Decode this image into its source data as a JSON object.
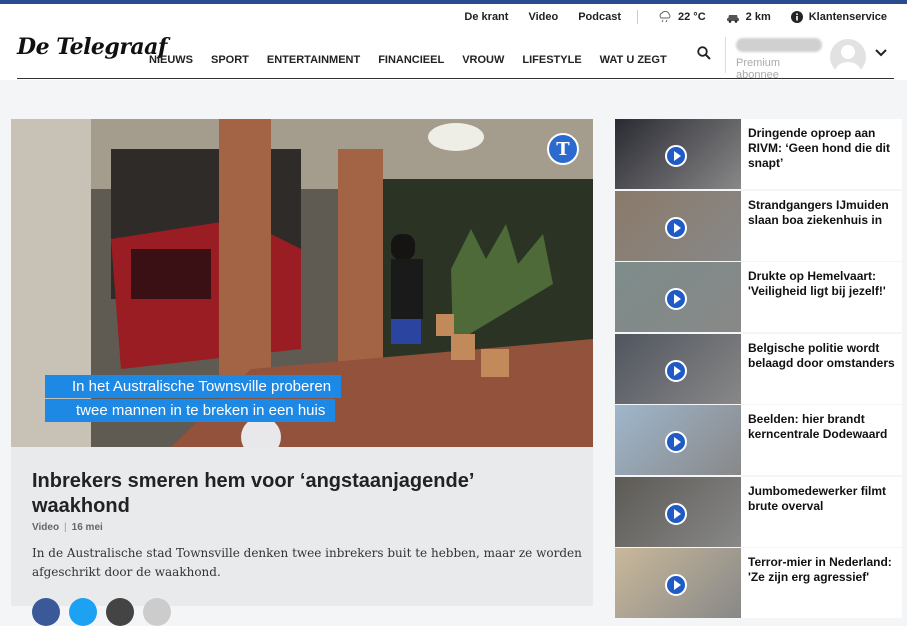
{
  "utility": {
    "krant": "De krant",
    "video": "Video",
    "podcast": "Podcast",
    "weather": "22 °C",
    "traffic": "2 km",
    "service": "Klantenservice"
  },
  "brand": {
    "logo": "De Telegraaf"
  },
  "nav": [
    "NIEUWS",
    "SPORT",
    "ENTERTAINMENT",
    "FINANCIEEL",
    "VROUW",
    "LIFESTYLE",
    "WAT U ZEGT"
  ],
  "account": {
    "subscription": "Premium abonnee"
  },
  "hero": {
    "badge": "T",
    "caption_line1": "In het Australische Townsville proberen",
    "caption_line2": "twee mannen in te breken in een huis",
    "title": "Inbrekers smeren hem voor ‘angstaanjagende’ waakhond",
    "category": "Video",
    "date": "16 mei",
    "lead": "In de Australische stad Townsville denken twee inbrekers buit te hebben, maar ze worden afgeschrikt door de waakhond."
  },
  "sidebar": [
    {
      "title": "Dringende oproep aan RIVM: ‘Geen hond die dit snapt’",
      "thumb": "#2a2a33"
    },
    {
      "title": "Strandgangers IJmuiden slaan boa ziekenhuis in",
      "thumb": "#8a7a6a"
    },
    {
      "title": "Drukte op Hemelvaart: 'Veiligheid ligt bij jezelf!'",
      "thumb": "#7d8c8a"
    },
    {
      "title": "Belgische politie wordt belaagd door omstanders",
      "thumb": "#50555e"
    },
    {
      "title": "Beelden: hier brandt kerncentrale Dodewaard",
      "thumb": "#9fb6cc"
    },
    {
      "title": "Jumbomedewerker filmt brute overval",
      "thumb": "#5d5a55"
    },
    {
      "title": "Terror-mier in Nederland: 'Ze zijn erg agressief'",
      "thumb": "#c9b89a"
    }
  ],
  "colors": {
    "accent": "#1e88e5",
    "brand": "#2b4b8f"
  }
}
